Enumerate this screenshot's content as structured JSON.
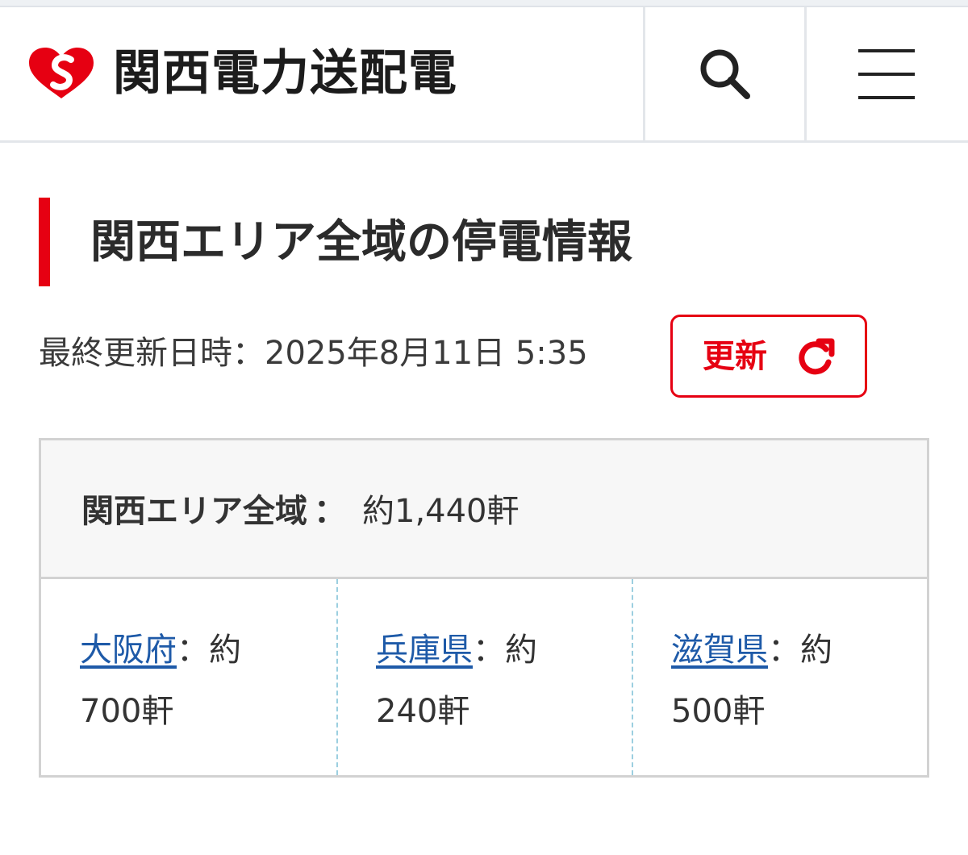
{
  "header": {
    "logo_text": "関西電力送配電",
    "brand_color": "#e60012",
    "icons": [
      "logo-mark-icon",
      "search-icon",
      "hamburger-menu-icon"
    ]
  },
  "page": {
    "title": "関西エリア全域の停電情報",
    "last_updated_label": "最終更新日時：",
    "last_updated_value": "2025年8月11日 5:35"
  },
  "refresh_button": {
    "label": "更新",
    "icon": "refresh-icon"
  },
  "summary": {
    "area_label": "関西エリア全域",
    "area_colon": "：",
    "area_count": "約1,440軒",
    "prefectures": [
      {
        "name": "大阪府",
        "prefix": "：約",
        "count": "700軒"
      },
      {
        "name": "兵庫県",
        "prefix": "：約",
        "count": "240軒"
      },
      {
        "name": "滋賀県",
        "prefix": "：約",
        "count": "500軒"
      }
    ]
  },
  "colors": {
    "accent_red": "#e60012",
    "link_blue": "#1e5aa8",
    "divider_dashed": "#9ccfe0",
    "summary_header_bg": "#f7f7f7"
  }
}
